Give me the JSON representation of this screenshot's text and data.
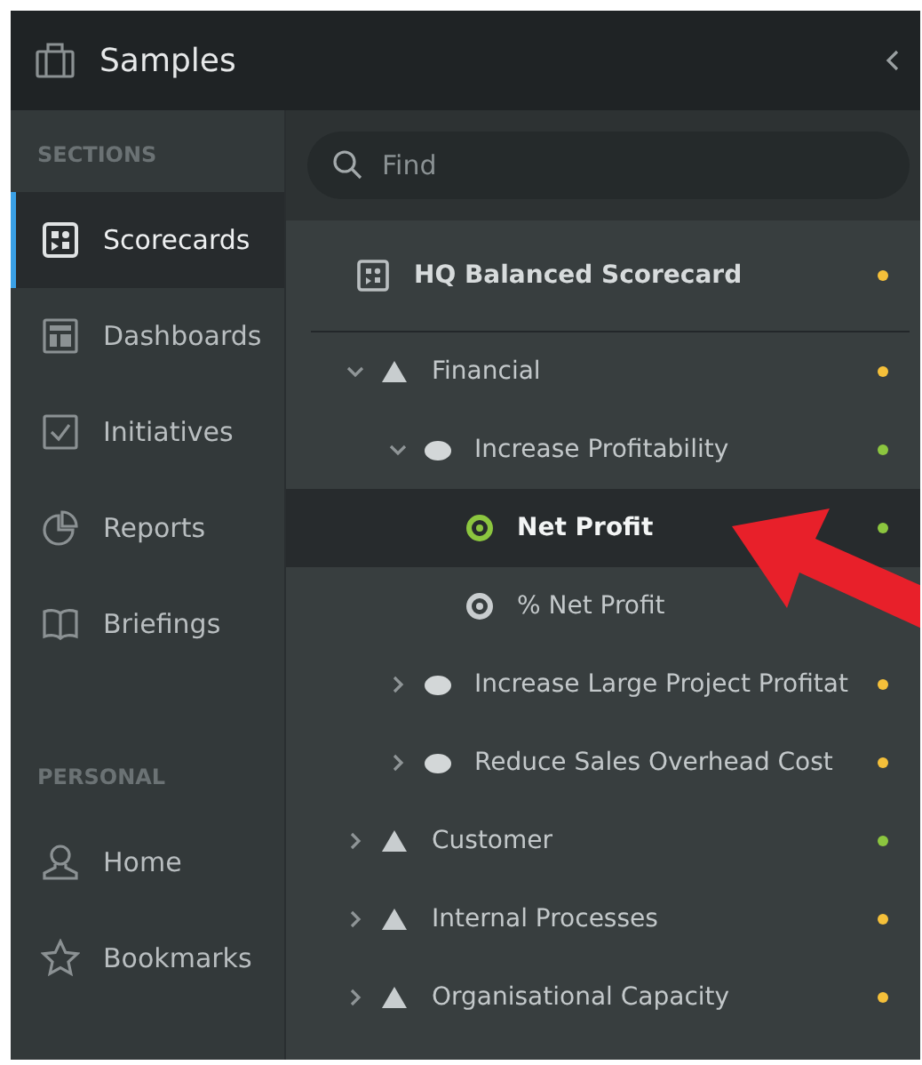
{
  "header": {
    "title": "Samples"
  },
  "sidebar": {
    "groups": [
      {
        "heading": "SECTIONS",
        "items": [
          {
            "label": "Scorecards",
            "selected": true
          },
          {
            "label": "Dashboards",
            "selected": false
          },
          {
            "label": "Initiatives",
            "selected": false
          },
          {
            "label": "Reports",
            "selected": false
          },
          {
            "label": "Briefings",
            "selected": false
          }
        ]
      },
      {
        "heading": "PERSONAL",
        "items": [
          {
            "label": "Home",
            "selected": false
          },
          {
            "label": "Bookmarks",
            "selected": false
          }
        ]
      }
    ]
  },
  "search": {
    "placeholder": "Find"
  },
  "scorecard": {
    "title": "HQ Balanced Scorecard",
    "color": "#f5c03a"
  },
  "tree": [
    {
      "kind": "perspective",
      "label": "Financial",
      "color": "#f5c03a",
      "expanded": true,
      "selected": false,
      "children": [
        {
          "kind": "objective",
          "label": "Increase Profitability",
          "color": "#8cc63f",
          "expanded": true,
          "selected": false,
          "children": [
            {
              "kind": "measure",
              "label": "Net Profit",
              "color": "#8cc63f",
              "selected": true
            },
            {
              "kind": "measure",
              "label": "% Net Profit",
              "selected": false
            }
          ]
        },
        {
          "kind": "objective",
          "label": "Increase Large Project Profitat",
          "color": "#f5c03a",
          "expanded": false,
          "selected": false
        },
        {
          "kind": "objective",
          "label": "Reduce Sales Overhead Cost",
          "color": "#f5c03a",
          "expanded": false,
          "selected": false
        }
      ]
    },
    {
      "kind": "perspective",
      "label": "Customer",
      "color": "#8cc63f",
      "expanded": false,
      "selected": false
    },
    {
      "kind": "perspective",
      "label": "Internal Processes",
      "color": "#f5c03a",
      "expanded": false,
      "selected": false
    },
    {
      "kind": "perspective",
      "label": "Organisational Capacity",
      "color": "#f5c03a",
      "expanded": false,
      "selected": false
    }
  ]
}
